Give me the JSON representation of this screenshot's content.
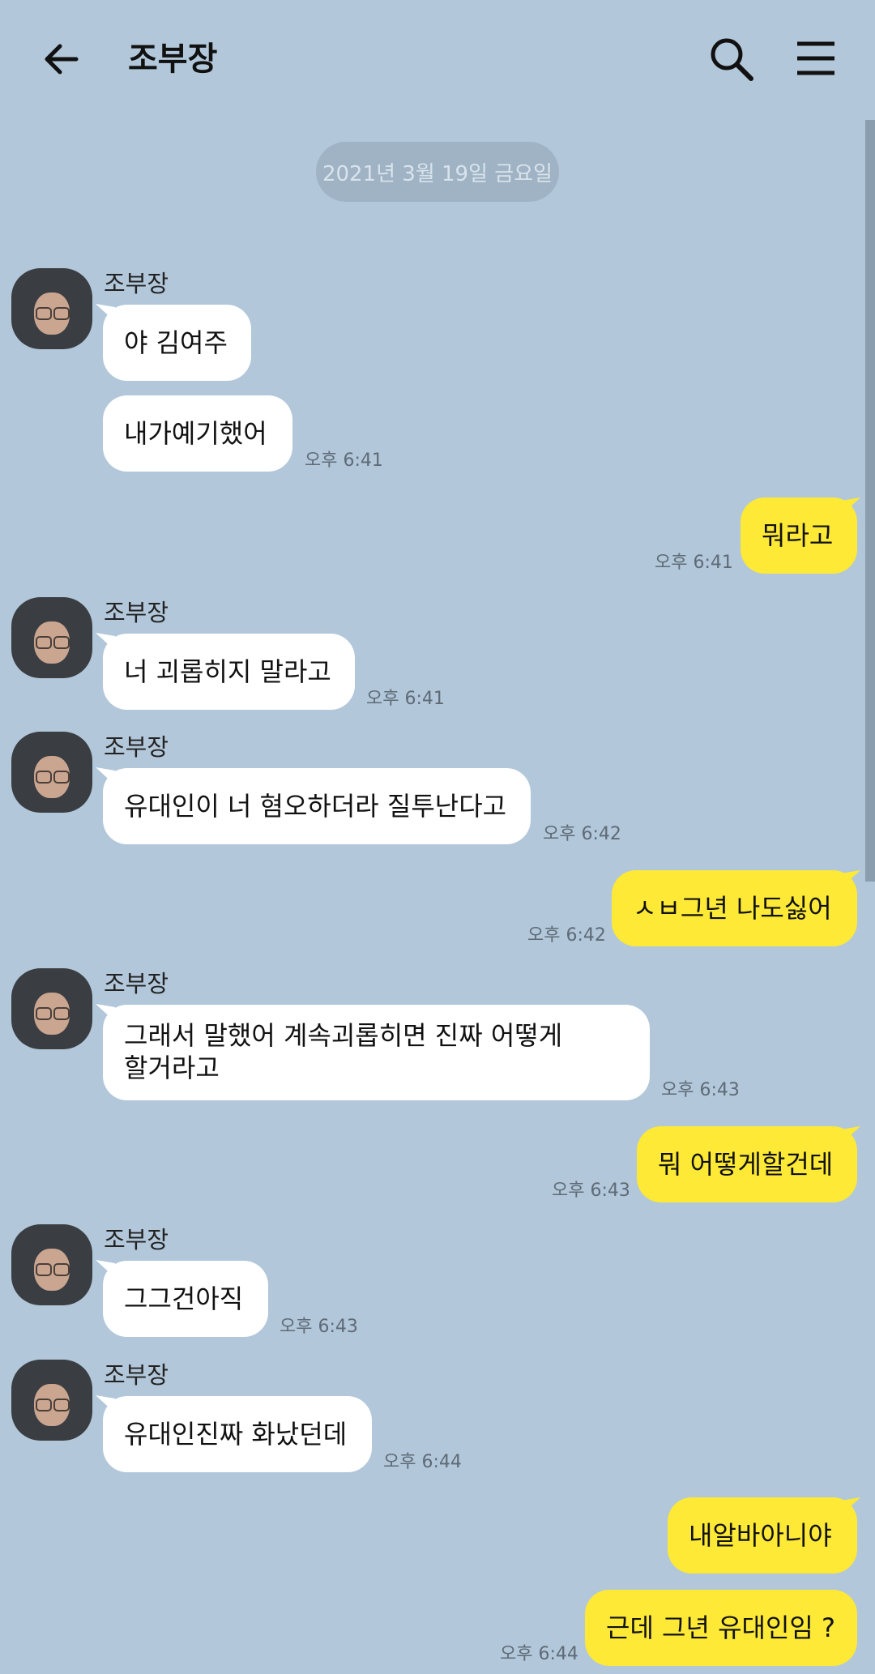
{
  "header": {
    "title": "조부장"
  },
  "date_divider": "2021년 3월 19일 금요일",
  "sender_name": "조부장",
  "messages": [
    {
      "text": "야 김여주",
      "time": ""
    },
    {
      "text": "내가예기했어",
      "time": "오후 6:41"
    },
    {
      "text": "뭐라고",
      "time": "오후 6:41"
    },
    {
      "text": "너 괴롭히지 말라고",
      "time": "오후 6:41"
    },
    {
      "text": "유대인이 너 혐오하더라 질투난다고",
      "time": "오후 6:42"
    },
    {
      "text": "ㅅㅂ그년 나도싫어",
      "time": "오후 6:42"
    },
    {
      "text_line1": "그래서 말했어 계속괴롭히면 진짜 어떻게",
      "text_line2": "할거라고",
      "time": "오후 6:43"
    },
    {
      "text": "뭐 어떻게할건데",
      "time": "오후 6:43"
    },
    {
      "text": "그그건아직",
      "time": "오후 6:43"
    },
    {
      "text": "유대인진짜 화났던데",
      "time": "오후 6:44"
    },
    {
      "text": "내알바아니야",
      "time": ""
    },
    {
      "text": "근데 그년 유대인임 ?",
      "time": "오후 6:44"
    }
  ],
  "colors": {
    "background": "#b2c7da",
    "incoming": "#ffffff",
    "outgoing": "#fde936"
  },
  "icons": [
    "back-arrow-icon",
    "search-icon",
    "menu-icon"
  ]
}
